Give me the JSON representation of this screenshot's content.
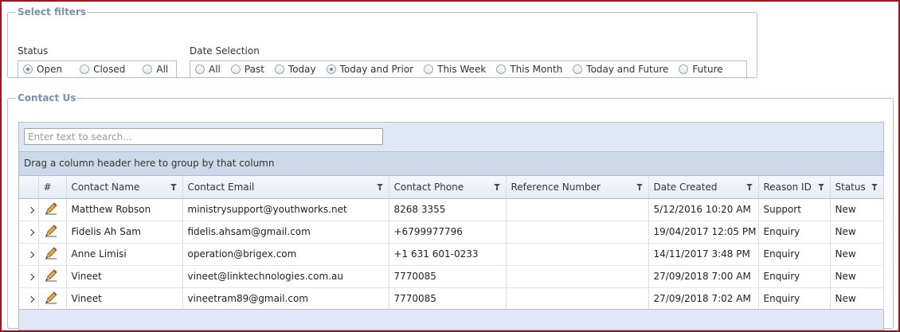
{
  "filters": {
    "legend": "Select filters",
    "status": {
      "label": "Status",
      "options": [
        {
          "label": "Open",
          "selected": true
        },
        {
          "label": "Closed",
          "selected": false
        },
        {
          "label": "All",
          "selected": false
        }
      ]
    },
    "date": {
      "label": "Date Selection",
      "options": [
        {
          "label": "All",
          "selected": false
        },
        {
          "label": "Past",
          "selected": false
        },
        {
          "label": "Today",
          "selected": false
        },
        {
          "label": "Today and Prior",
          "selected": true
        },
        {
          "label": "This Week",
          "selected": false
        },
        {
          "label": "This Month",
          "selected": false
        },
        {
          "label": "Today and Future",
          "selected": false
        },
        {
          "label": "Future",
          "selected": false
        }
      ]
    }
  },
  "contact": {
    "legend": "Contact Us",
    "search_placeholder": "Enter text to search...",
    "group_panel_text": "Drag a column header here to group by that column",
    "columns": [
      "#",
      "Contact Name",
      "Contact Email",
      "Contact Phone",
      "Reference Number",
      "Date Created",
      "Reason ID",
      "Status"
    ],
    "rows": [
      {
        "name": "Matthew Robson",
        "email": "ministrysupport@youthworks.net",
        "phone": "8268 3355",
        "ref": "",
        "date": "5/12/2016 10:20 AM",
        "reason": "Support",
        "status": "New"
      },
      {
        "name": "Fidelis Ah Sam",
        "email": "fidelis.ahsam@gmail.com",
        "phone": "+6799977796",
        "ref": "",
        "date": "19/04/2017 12:05 PM",
        "reason": "Enquiry",
        "status": "New"
      },
      {
        "name": "Anne Limisi",
        "email": "operation@brigex.com",
        "phone": "+1 631 601-0233",
        "ref": "",
        "date": "14/11/2017 3:48 PM",
        "reason": "Enquiry",
        "status": "New"
      },
      {
        "name": "Vineet",
        "email": "vineet@linktechnologies.com.au",
        "phone": "7770085",
        "ref": "",
        "date": "27/09/2018 7:00 AM",
        "reason": "Enquiry",
        "status": "New"
      },
      {
        "name": "Vineet",
        "email": "vineetram89@gmail.com",
        "phone": "7770085",
        "ref": "",
        "date": "27/09/2018 7:02 AM",
        "reason": "Enquiry",
        "status": "New"
      }
    ]
  },
  "colors": {
    "frame_border": "#a4131c",
    "legend_text": "#7393b7",
    "group_panel_bg": "#cbd9e9"
  }
}
